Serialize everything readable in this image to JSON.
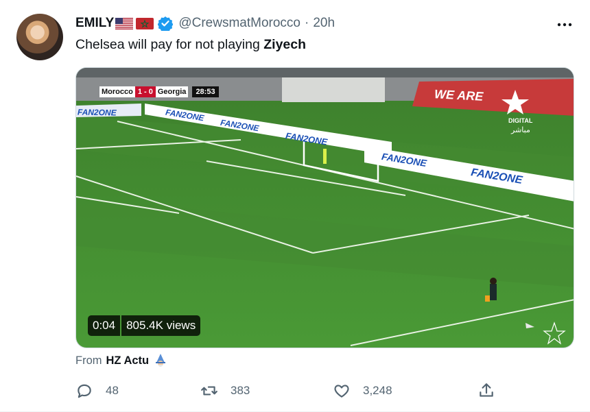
{
  "author": {
    "display_name": "EMILY",
    "handle": "@CrewsmatMorocco",
    "time": "20h"
  },
  "tweet": {
    "text_pre": "Chelsea will pay for not playing ",
    "text_bold": "Ziyech"
  },
  "video": {
    "elapsed": "0:04",
    "views": "805.4K views",
    "scoreboard": {
      "home": "Morocco",
      "score": "1 - 0",
      "away": "Georgia",
      "clock": "28:53"
    },
    "board_text": "FAN2ONE",
    "banner_text": "WE ARE",
    "channel": "DIGITAL",
    "channel_ar": "مباشر"
  },
  "source": {
    "prefix": "From",
    "name": "HZ Actu"
  },
  "actions": {
    "replies": "48",
    "retweets": "383",
    "likes": "3,248"
  },
  "colors": {
    "accent": "#1d9bf0",
    "muted": "#536471",
    "pitch": "#3f8a2f"
  }
}
